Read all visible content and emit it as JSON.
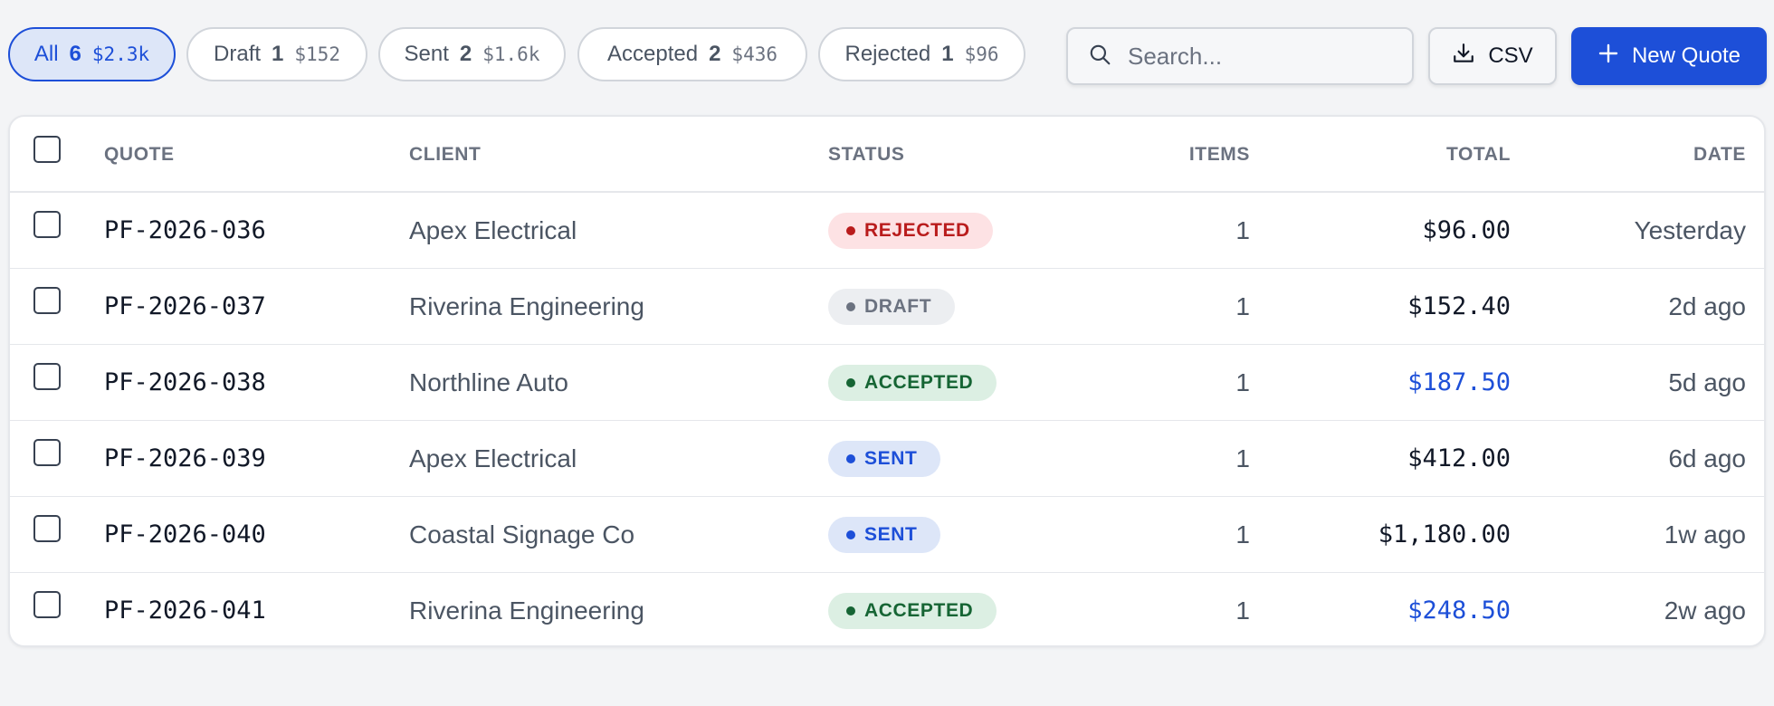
{
  "filters": [
    {
      "label": "All",
      "count": "6",
      "amount": "$2.3k",
      "active": true
    },
    {
      "label": "Draft",
      "count": "1",
      "amount": "$152",
      "active": false
    },
    {
      "label": "Sent",
      "count": "2",
      "amount": "$1.6k",
      "active": false
    },
    {
      "label": "Accepted",
      "count": "2",
      "amount": "$436",
      "active": false
    },
    {
      "label": "Rejected",
      "count": "1",
      "amount": "$96",
      "active": false
    }
  ],
  "search": {
    "placeholder": "Search...",
    "icon": "search-icon"
  },
  "csv_button": {
    "label": "CSV",
    "icon": "download-icon"
  },
  "new_button": {
    "label": "New Quote",
    "icon": "plus-icon"
  },
  "columns": {
    "quote": "QUOTE",
    "client": "CLIENT",
    "status": "STATUS",
    "items": "ITEMS",
    "total": "TOTAL",
    "date": "DATE"
  },
  "status_colors": {
    "REJECTED": {
      "bg": "#fde2e4",
      "fg": "#b91c1c",
      "dot": "#b91c1c"
    },
    "DRAFT": {
      "bg": "#eceef1",
      "fg": "#6b7280",
      "dot": "#6b7280"
    },
    "ACCEPTED": {
      "bg": "#dcefe3",
      "fg": "#166534",
      "dot": "#166534"
    },
    "SENT": {
      "bg": "#dde6f8",
      "fg": "#1d4fd8",
      "dot": "#1d4fd8"
    }
  },
  "accent_color": "#1d4fd8",
  "rows": [
    {
      "quote": "PF-2026-036",
      "client": "Apex Electrical",
      "status": "REJECTED",
      "items": "1",
      "total": "$96.00",
      "total_accent": false,
      "date": "Yesterday"
    },
    {
      "quote": "PF-2026-037",
      "client": "Riverina Engineering",
      "status": "DRAFT",
      "items": "1",
      "total": "$152.40",
      "total_accent": false,
      "date": "2d ago"
    },
    {
      "quote": "PF-2026-038",
      "client": "Northline Auto",
      "status": "ACCEPTED",
      "items": "1",
      "total": "$187.50",
      "total_accent": true,
      "date": "5d ago"
    },
    {
      "quote": "PF-2026-039",
      "client": "Apex Electrical",
      "status": "SENT",
      "items": "1",
      "total": "$412.00",
      "total_accent": false,
      "date": "6d ago"
    },
    {
      "quote": "PF-2026-040",
      "client": "Coastal Signage Co",
      "status": "SENT",
      "items": "1",
      "total": "$1,180.00",
      "total_accent": false,
      "date": "1w ago"
    },
    {
      "quote": "PF-2026-041",
      "client": "Riverina Engineering",
      "status": "ACCEPTED",
      "items": "1",
      "total": "$248.50",
      "total_accent": true,
      "date": "2w ago"
    }
  ]
}
